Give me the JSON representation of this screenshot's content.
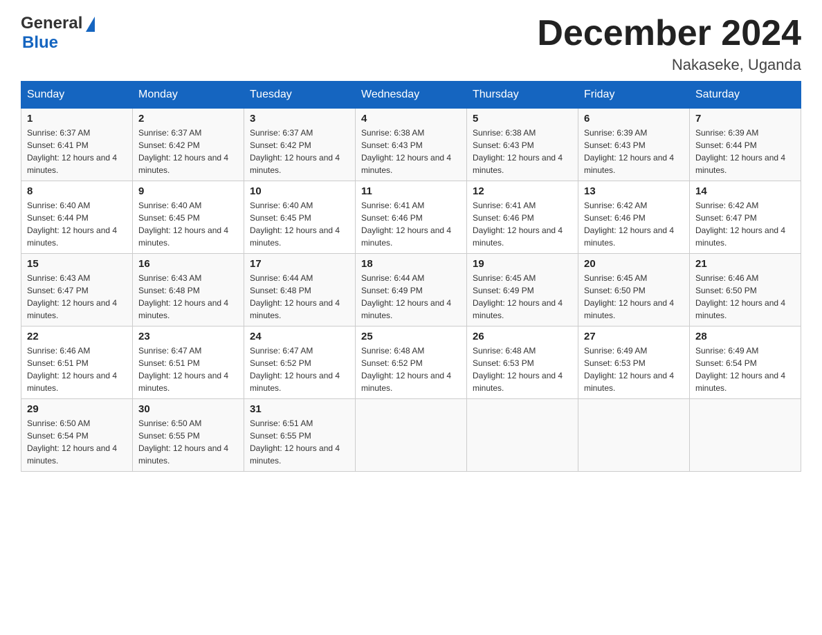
{
  "logo": {
    "text_general": "General",
    "text_blue": "Blue",
    "arrow_unicode": "▶"
  },
  "header": {
    "month_year": "December 2024",
    "location": "Nakaseke, Uganda"
  },
  "days_of_week": [
    "Sunday",
    "Monday",
    "Tuesday",
    "Wednesday",
    "Thursday",
    "Friday",
    "Saturday"
  ],
  "weeks": [
    [
      {
        "day": "1",
        "sunrise": "6:37 AM",
        "sunset": "6:41 PM",
        "daylight": "12 hours and 4 minutes."
      },
      {
        "day": "2",
        "sunrise": "6:37 AM",
        "sunset": "6:42 PM",
        "daylight": "12 hours and 4 minutes."
      },
      {
        "day": "3",
        "sunrise": "6:37 AM",
        "sunset": "6:42 PM",
        "daylight": "12 hours and 4 minutes."
      },
      {
        "day": "4",
        "sunrise": "6:38 AM",
        "sunset": "6:43 PM",
        "daylight": "12 hours and 4 minutes."
      },
      {
        "day": "5",
        "sunrise": "6:38 AM",
        "sunset": "6:43 PM",
        "daylight": "12 hours and 4 minutes."
      },
      {
        "day": "6",
        "sunrise": "6:39 AM",
        "sunset": "6:43 PM",
        "daylight": "12 hours and 4 minutes."
      },
      {
        "day": "7",
        "sunrise": "6:39 AM",
        "sunset": "6:44 PM",
        "daylight": "12 hours and 4 minutes."
      }
    ],
    [
      {
        "day": "8",
        "sunrise": "6:40 AM",
        "sunset": "6:44 PM",
        "daylight": "12 hours and 4 minutes."
      },
      {
        "day": "9",
        "sunrise": "6:40 AM",
        "sunset": "6:45 PM",
        "daylight": "12 hours and 4 minutes."
      },
      {
        "day": "10",
        "sunrise": "6:40 AM",
        "sunset": "6:45 PM",
        "daylight": "12 hours and 4 minutes."
      },
      {
        "day": "11",
        "sunrise": "6:41 AM",
        "sunset": "6:46 PM",
        "daylight": "12 hours and 4 minutes."
      },
      {
        "day": "12",
        "sunrise": "6:41 AM",
        "sunset": "6:46 PM",
        "daylight": "12 hours and 4 minutes."
      },
      {
        "day": "13",
        "sunrise": "6:42 AM",
        "sunset": "6:46 PM",
        "daylight": "12 hours and 4 minutes."
      },
      {
        "day": "14",
        "sunrise": "6:42 AM",
        "sunset": "6:47 PM",
        "daylight": "12 hours and 4 minutes."
      }
    ],
    [
      {
        "day": "15",
        "sunrise": "6:43 AM",
        "sunset": "6:47 PM",
        "daylight": "12 hours and 4 minutes."
      },
      {
        "day": "16",
        "sunrise": "6:43 AM",
        "sunset": "6:48 PM",
        "daylight": "12 hours and 4 minutes."
      },
      {
        "day": "17",
        "sunrise": "6:44 AM",
        "sunset": "6:48 PM",
        "daylight": "12 hours and 4 minutes."
      },
      {
        "day": "18",
        "sunrise": "6:44 AM",
        "sunset": "6:49 PM",
        "daylight": "12 hours and 4 minutes."
      },
      {
        "day": "19",
        "sunrise": "6:45 AM",
        "sunset": "6:49 PM",
        "daylight": "12 hours and 4 minutes."
      },
      {
        "day": "20",
        "sunrise": "6:45 AM",
        "sunset": "6:50 PM",
        "daylight": "12 hours and 4 minutes."
      },
      {
        "day": "21",
        "sunrise": "6:46 AM",
        "sunset": "6:50 PM",
        "daylight": "12 hours and 4 minutes."
      }
    ],
    [
      {
        "day": "22",
        "sunrise": "6:46 AM",
        "sunset": "6:51 PM",
        "daylight": "12 hours and 4 minutes."
      },
      {
        "day": "23",
        "sunrise": "6:47 AM",
        "sunset": "6:51 PM",
        "daylight": "12 hours and 4 minutes."
      },
      {
        "day": "24",
        "sunrise": "6:47 AM",
        "sunset": "6:52 PM",
        "daylight": "12 hours and 4 minutes."
      },
      {
        "day": "25",
        "sunrise": "6:48 AM",
        "sunset": "6:52 PM",
        "daylight": "12 hours and 4 minutes."
      },
      {
        "day": "26",
        "sunrise": "6:48 AM",
        "sunset": "6:53 PM",
        "daylight": "12 hours and 4 minutes."
      },
      {
        "day": "27",
        "sunrise": "6:49 AM",
        "sunset": "6:53 PM",
        "daylight": "12 hours and 4 minutes."
      },
      {
        "day": "28",
        "sunrise": "6:49 AM",
        "sunset": "6:54 PM",
        "daylight": "12 hours and 4 minutes."
      }
    ],
    [
      {
        "day": "29",
        "sunrise": "6:50 AM",
        "sunset": "6:54 PM",
        "daylight": "12 hours and 4 minutes."
      },
      {
        "day": "30",
        "sunrise": "6:50 AM",
        "sunset": "6:55 PM",
        "daylight": "12 hours and 4 minutes."
      },
      {
        "day": "31",
        "sunrise": "6:51 AM",
        "sunset": "6:55 PM",
        "daylight": "12 hours and 4 minutes."
      },
      null,
      null,
      null,
      null
    ]
  ]
}
